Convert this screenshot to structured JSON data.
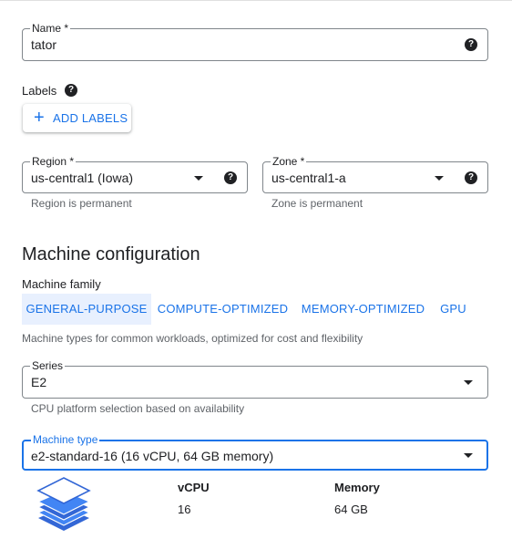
{
  "name_field": {
    "label": "Name *",
    "value": "tator",
    "help_icon": "help-circle-icon"
  },
  "labels": {
    "title": "Labels",
    "help_icon": "help-circle-icon",
    "add_button": {
      "icon": "plus-icon",
      "label": "ADD LABELS"
    }
  },
  "region": {
    "label": "Region *",
    "value": "us-central1 (Iowa)",
    "hint": "Region is permanent"
  },
  "zone": {
    "label": "Zone *",
    "value": "us-central1-a",
    "hint": "Zone is permanent"
  },
  "machine_config": {
    "heading": "Machine configuration",
    "family_label": "Machine family",
    "families": [
      {
        "label": "GENERAL-PURPOSE",
        "selected": true
      },
      {
        "label": "COMPUTE-OPTIMIZED",
        "selected": false
      },
      {
        "label": "MEMORY-OPTIMIZED",
        "selected": false
      },
      {
        "label": "GPU",
        "selected": false
      }
    ],
    "family_description": "Machine types for common workloads, optimized for cost and flexibility",
    "series": {
      "label": "Series",
      "value": "E2",
      "hint": "CPU platform selection based on availability"
    },
    "machine_type": {
      "label": "Machine type",
      "value": "e2-standard-16 (16 vCPU, 64 GB memory)"
    },
    "stats": {
      "vcpu_label": "vCPU",
      "vcpu_value": "16",
      "memory_label": "Memory",
      "memory_value": "64 GB"
    }
  },
  "colors": {
    "accent": "#1a73e8",
    "tab_selected_bg": "#e8f0fe",
    "stack_icon": "#3367d6"
  }
}
